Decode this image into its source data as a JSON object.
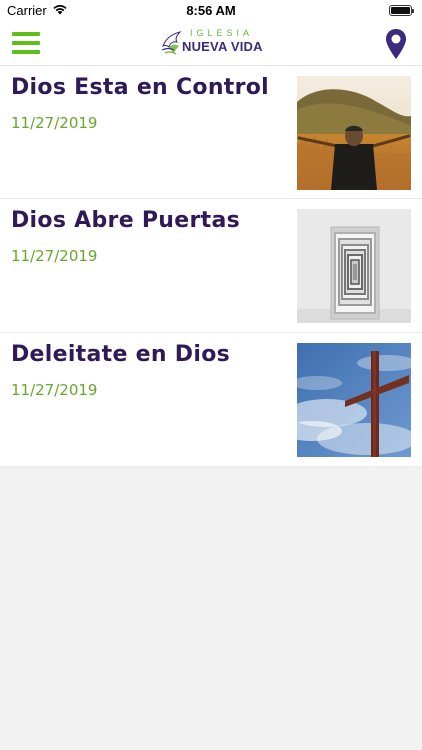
{
  "status_bar": {
    "carrier": "Carrier",
    "time": "8:56 AM",
    "battery_level": 1.0
  },
  "nav": {
    "menu_icon": "hamburger-menu-icon",
    "logo_top_text": "IGLESIA",
    "logo_main_text": "NUEVA VIDA",
    "location_icon": "map-pin-icon",
    "accent_color": "#5cc018",
    "brand_color": "#3b2a7d"
  },
  "sermons": [
    {
      "title": "Dios Esta en Control",
      "date": "11/27/2019",
      "image": "man-arms-raised-field"
    },
    {
      "title": "Dios Abre Puertas",
      "date": "11/27/2019",
      "image": "nested-doorways"
    },
    {
      "title": "Deleitate en Dios",
      "date": "11/27/2019",
      "image": "cross-against-sky"
    }
  ],
  "colors": {
    "title": "#2f1a57",
    "date": "#67a82b",
    "background": "#f2f2f2"
  }
}
